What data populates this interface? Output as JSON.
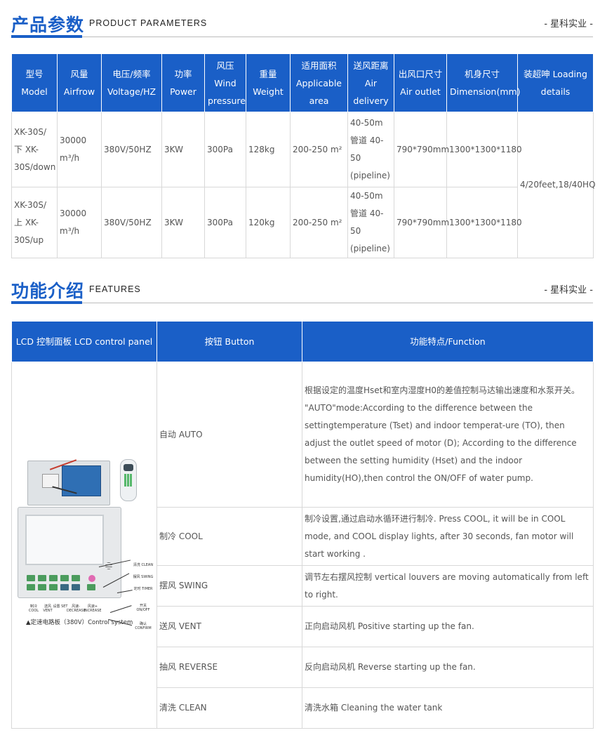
{
  "section1": {
    "title_cn": "产品参数",
    "title_en": "PRODUCT PARAMETERS",
    "brand": "- 星科实业 -"
  },
  "params_table": {
    "headers": [
      "型号 Model",
      "风量 Airfrow",
      "电压/频率 Voltage/HZ",
      "功率 Power",
      "风压 Wind pressure",
      "重量 Weight",
      "适用面积 Applicable area",
      "送风距离 Air delivery",
      "出风口尺寸 Air outlet",
      "机身尺寸 Dimension(mm)",
      "装超呻 Loading details"
    ],
    "rows": [
      [
        "XK-30S/下 XK-30S/down",
        "30000 m³/h",
        "380V/50HZ",
        "3KW",
        "300Pa",
        "128kg",
        "200-250 m²",
        "40-50m管道 40-50 (pipeline)",
        "790*790mm",
        "1300*1300*1180"
      ],
      [
        "XK-30S/上 XK-30S/up",
        "30000 m³/h",
        "380V/50HZ",
        "3KW",
        "300Pa",
        "120kg",
        "200-250 m²",
        "40-50m管道 40-50 (pipeline)",
        "790*790mm",
        "1300*1300*1180"
      ]
    ],
    "loading": "4/20feet,18/40HQ"
  },
  "section2": {
    "title_cn": "功能介绍",
    "title_en": "FEATURES",
    "brand": "- 星科实业 -"
  },
  "features_table": {
    "headers": [
      "LCD 控制面板 LCD control panel",
      "按钮 Button",
      "功能特点/Function"
    ],
    "panel_labels": {
      "clean": "清洗 CLEAN",
      "swing": "摆风 SWING",
      "timer": "定时 TIMER",
      "onoff": "开关 ON/OFF",
      "confirm": "确认 CONFIRM",
      "cool": "制冷 COOL",
      "vent": "送风 VENT",
      "set": "设置 SET",
      "decrease": "风速- DECREASE",
      "increase": "风速+ INCREASE"
    },
    "panel_caption": "▲定速电路板（380V）Control system",
    "rows": [
      {
        "button": "自动 AUTO",
        "function": "根据设定的温度Hset和室内湿度H0的差值控制马达输出速度和水泵开关。 \"AUTO\"mode:According to the difference between the settingtemperature (Tset) and indoor temperat-ure (TO), then adjust the outlet speed of motor (D); According to the difference between the setting humidity (Hset) and the indoor humidity(HO),then control the ON/OFF of water pump."
      },
      {
        "button": "制冷 COOL",
        "function": "制冷设置,通过启动水循环进行制冷. Press COOL, it will be in COOL mode, and COOL display lights, after 30 seconds, fan motor will start working ."
      },
      {
        "button": "摆风 SWING",
        "function": "调节左右摆风控制 vertical louvers are moving automatically from left to right."
      },
      {
        "button": "送风 VENT",
        "function": "正向启动风机 Positive starting up the fan."
      },
      {
        "button": "抽风 REVERSE",
        "function": "反向启动风机 Reverse starting up the fan."
      },
      {
        "button": "清洗 CLEAN",
        "function": "清洗水箱 Cleaning the water tank"
      }
    ]
  }
}
